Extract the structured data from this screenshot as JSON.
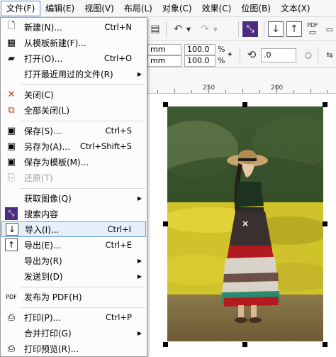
{
  "menubar": {
    "items": [
      {
        "label": "文件(F)",
        "active": true
      },
      {
        "label": "编辑(E)"
      },
      {
        "label": "视图(V)"
      },
      {
        "label": "布局(L)"
      },
      {
        "label": "对象(C)"
      },
      {
        "label": "效果(C)"
      },
      {
        "label": "位图(B)"
      },
      {
        "label": "文本(X)"
      }
    ]
  },
  "file_menu": {
    "items": [
      {
        "label": "新建(N)...",
        "shortcut": "Ctrl+N",
        "icon": "new-doc-icon"
      },
      {
        "label": "从模板新建(F)...",
        "shortcut": "",
        "icon": "template-new-icon"
      },
      {
        "label": "打开(O)...",
        "shortcut": "Ctrl+O",
        "icon": "open-folder-icon"
      },
      {
        "label": "打开最近用过的文件(R)",
        "shortcut": "",
        "icon": "",
        "submenu": true
      },
      {
        "label": "关闭(C)",
        "shortcut": "",
        "icon": "close-doc-icon"
      },
      {
        "label": "全部关闭(L)",
        "shortcut": "",
        "icon": "close-all-icon"
      },
      {
        "label": "保存(S)...",
        "shortcut": "Ctrl+S",
        "icon": "save-icon"
      },
      {
        "label": "另存为(A)...",
        "shortcut": "Ctrl+Shift+S",
        "icon": "save-as-icon"
      },
      {
        "label": "保存为模板(M)...",
        "shortcut": "",
        "icon": "save-template-icon"
      },
      {
        "label": "还原(T)",
        "shortcut": "",
        "icon": "revert-icon",
        "disabled": true
      },
      {
        "label": "获取图像(Q)",
        "shortcut": "",
        "icon": "",
        "submenu": true
      },
      {
        "label": "搜索内容",
        "shortcut": "",
        "icon": "search-content-icon"
      },
      {
        "label": "导入(I)...",
        "shortcut": "Ctrl+I",
        "icon": "import-icon",
        "highlighted": true
      },
      {
        "label": "导出(E)...",
        "shortcut": "Ctrl+E",
        "icon": "export-icon"
      },
      {
        "label": "导出为(R)",
        "shortcut": "",
        "icon": "",
        "submenu": true
      },
      {
        "label": "发送到(D)",
        "shortcut": "",
        "icon": "",
        "submenu": true
      },
      {
        "label": "发布为 PDF(H)",
        "shortcut": "",
        "icon": "pdf-icon"
      },
      {
        "label": "打印(P)...",
        "shortcut": "Ctrl+P",
        "icon": "print-icon"
      },
      {
        "label": "合并打印(G)",
        "shortcut": "",
        "icon": "",
        "submenu": true
      },
      {
        "label": "打印预览(R)...",
        "shortcut": "",
        "icon": "print-preview-icon"
      }
    ]
  },
  "propbar": {
    "width_mm": "mm",
    "height_mm": "mm",
    "scale_x": "100.0",
    "scale_y": "100.0",
    "pct": "%",
    "rotation": ".0"
  },
  "toolbar": {
    "pdf_label": "PDF"
  },
  "ruler": {
    "label_250": "250",
    "label_200": "200"
  },
  "colors": {
    "menu_highlight": "#e5f0fb",
    "menu_highlight_border": "#6a9cd8",
    "active_tool": "#4a2d80"
  }
}
